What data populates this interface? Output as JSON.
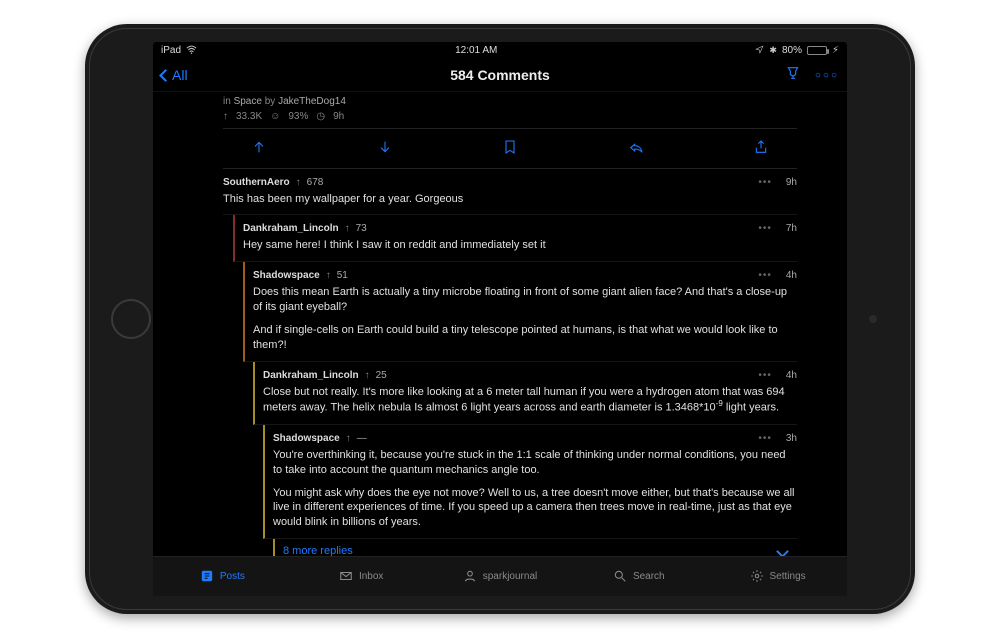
{
  "status": {
    "device": "iPad",
    "time": "12:01 AM",
    "battery_pct": "80%",
    "bt": "✶",
    "loc": "➤"
  },
  "nav": {
    "back_label": "All",
    "title": "584 Comments",
    "sort_icon": "trophy",
    "more_icon": "ooo"
  },
  "post": {
    "in_label": "in",
    "subreddit": "Space",
    "by_label": "by",
    "author": "JakeTheDog14",
    "upvotes": "33.3K",
    "ratio": "93%",
    "age": "9h"
  },
  "actions": {
    "upvote": "upvote",
    "downvote": "downvote",
    "save": "save",
    "reply": "reply",
    "share": "share"
  },
  "comments": [
    {
      "user": "SouthernAero",
      "score": "678",
      "age": "9h",
      "indent": 0,
      "body": [
        "This has been my wallpaper for a year. Gorgeous"
      ]
    },
    {
      "user": "Dankraham_Lincoln",
      "score": "73",
      "age": "7h",
      "indent": 1,
      "body": [
        "Hey same here! I think I saw it on reddit and immediately set it"
      ]
    },
    {
      "user": "Shadowspace",
      "score": "51",
      "age": "4h",
      "indent": 2,
      "body": [
        "Does this mean Earth is actually a tiny microbe floating in front of some giant alien face? And that's a close-up of its giant eyeball?",
        "And if single-cells on Earth could build a tiny telescope pointed at humans, is that what we would look like to them?!"
      ]
    },
    {
      "user": "Dankraham_Lincoln",
      "score": "25",
      "age": "4h",
      "indent": 3,
      "body_html": "Close but not really. It's more like looking at a 6 meter tall human if you were a hydrogen atom that was 694 meters away. The helix nebula Is almost 6 light years across and earth diameter is 1.3468*10<sup>-9</sup> light years."
    },
    {
      "user": "Shadowspace",
      "score": "—",
      "age": "3h",
      "indent": 4,
      "body": [
        "You're overthinking it, because you're stuck in the 1:1 scale of thinking under normal conditions, you need to take into account the quantum mechanics angle too.",
        "You might ask why does the eye not move? Well to us, a tree doesn't move either, but that's because we all live in different experiences of time. If you speed up a camera then trees move in real-time, just as that eye would blink in billions of years."
      ]
    }
  ],
  "more_replies": "8 more replies",
  "tabs": {
    "posts": "Posts",
    "inbox": "Inbox",
    "profile": "sparkjournal",
    "search": "Search",
    "settings": "Settings"
  }
}
